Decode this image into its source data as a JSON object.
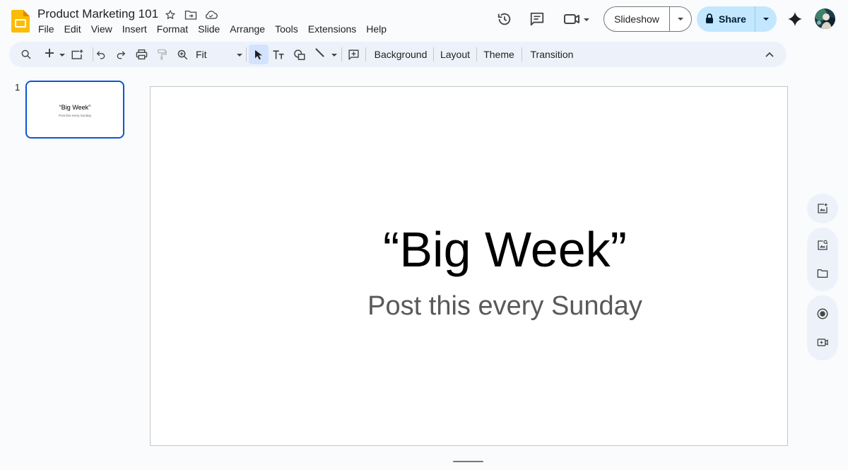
{
  "app": {
    "document_title": "Product Marketing 101",
    "brand_color": "#fbbc04"
  },
  "menu": [
    "File",
    "Edit",
    "View",
    "Insert",
    "Format",
    "Slide",
    "Arrange",
    "Tools",
    "Extensions",
    "Help"
  ],
  "header_icons": [
    "star-icon",
    "move-to-folder-icon",
    "cloud-saved-icon",
    "version-history-icon",
    "comments-icon",
    "meet-camera-icon"
  ],
  "buttons": {
    "slideshow": "Slideshow",
    "share": "Share"
  },
  "toolbar": {
    "zoom": "Fit",
    "background": "Background",
    "layout": "Layout",
    "theme": "Theme",
    "transition": "Transition"
  },
  "filmstrip": {
    "slides": [
      {
        "number": "1",
        "title": "“Big Week”",
        "subtitle": "Post this every Sunday"
      }
    ]
  },
  "slide": {
    "title": "“Big Week”",
    "subtitle": "Post this every Sunday"
  },
  "side_panel_icons": [
    "add-image-icon",
    "image-search-icon",
    "folder-icon",
    "record-icon",
    "video-add-icon"
  ],
  "colors": {
    "accent": "#0b57d0",
    "share_bg": "#c2e7ff",
    "toolbar_bg": "#edf2fa"
  }
}
